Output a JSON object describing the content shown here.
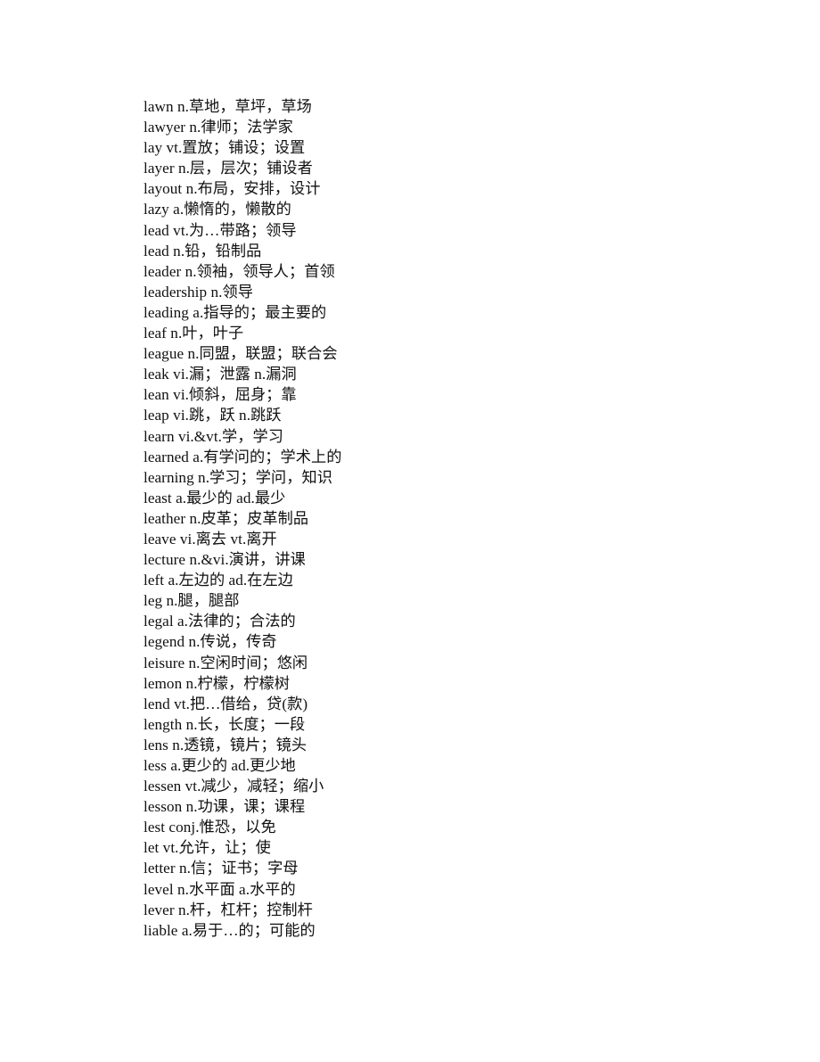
{
  "document": {
    "type": "vocabulary-word-list",
    "page_background": "#ffffff",
    "text_color": "#111111",
    "entries": [
      {
        "line": "lawn n.草地，草坪，草场"
      },
      {
        "line": "lawyer n.律师；法学家"
      },
      {
        "line": "lay vt.置放；铺设；设置"
      },
      {
        "line": "layer n.层，层次；铺设者"
      },
      {
        "line": "layout n.布局，安排，设计"
      },
      {
        "line": "lazy a.懒惰的，懒散的"
      },
      {
        "line": "lead vt.为…带路；领导"
      },
      {
        "line": "lead n.铅，铅制品"
      },
      {
        "line": "leader n.领袖，领导人；首领"
      },
      {
        "line": "leadership n.领导"
      },
      {
        "line": "leading a.指导的；最主要的"
      },
      {
        "line": "leaf n.叶，叶子"
      },
      {
        "line": "league n.同盟，联盟；联合会"
      },
      {
        "line": "leak vi.漏；泄露 n.漏洞"
      },
      {
        "line": "lean vi.倾斜，屈身；靠"
      },
      {
        "line": "leap vi.跳，跃 n.跳跃"
      },
      {
        "line": "learn vi.&vt.学，学习"
      },
      {
        "line": "learned a.有学问的；学术上的"
      },
      {
        "line": "learning n.学习；学问，知识"
      },
      {
        "line": "least a.最少的 ad.最少"
      },
      {
        "line": "leather n.皮革；皮革制品"
      },
      {
        "line": "leave vi.离去 vt.离开"
      },
      {
        "line": "lecture n.&vi.演讲，讲课"
      },
      {
        "line": "left a.左边的 ad.在左边"
      },
      {
        "line": "leg n.腿，腿部"
      },
      {
        "line": "legal a.法律的；合法的"
      },
      {
        "line": "legend n.传说，传奇"
      },
      {
        "line": "leisure n.空闲时间；悠闲"
      },
      {
        "line": "lemon n.柠檬，柠檬树"
      },
      {
        "line": "lend vt.把…借给，贷(款)"
      },
      {
        "line": "length n.长，长度；一段"
      },
      {
        "line": "lens n.透镜，镜片；镜头"
      },
      {
        "line": "less a.更少的 ad.更少地"
      },
      {
        "line": "lessen vt.减少，减轻；缩小"
      },
      {
        "line": "lesson n.功课，课；课程"
      },
      {
        "line": "lest conj.惟恐，以免"
      },
      {
        "line": "let vt.允许，让；使"
      },
      {
        "line": "letter n.信；证书；字母"
      },
      {
        "line": "level n.水平面 a.水平的"
      },
      {
        "line": "lever n.杆，杠杆；控制杆"
      },
      {
        "line": "liable a.易于…的；可能的"
      }
    ]
  }
}
